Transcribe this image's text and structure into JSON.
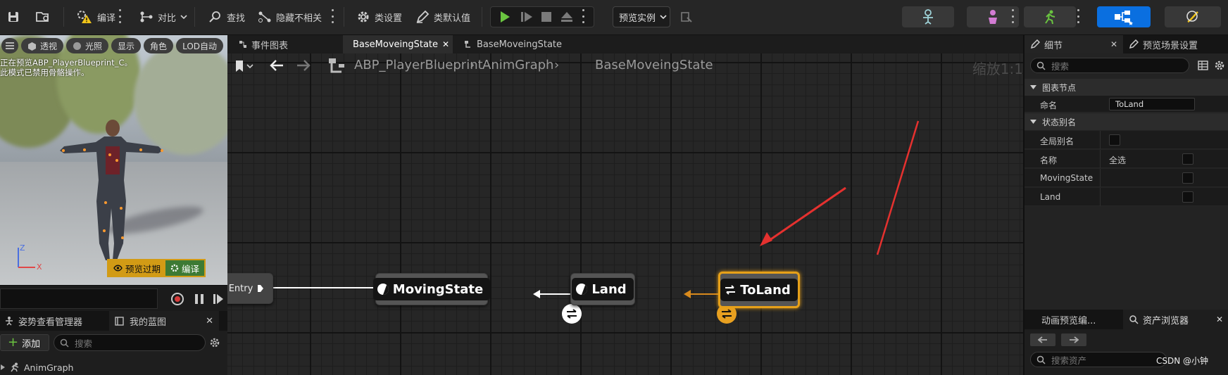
{
  "toolbar": {
    "compile_label": "编译",
    "diff_label": "对比",
    "find_label": "查找",
    "hide_unrelated_label": "隐藏不相关",
    "class_settings_label": "类设置",
    "class_defaults_label": "类默认值",
    "preview_instance_label": "预览实例"
  },
  "viewport": {
    "perspective_label": "透视",
    "lighting_label": "光照",
    "show_label": "显示",
    "character_label": "角色",
    "lod_label": "LOD自动",
    "info_line1": "正在预览ABP_PlayerBlueprint_C。",
    "info_line2": "此模式已禁用骨骼操作。",
    "axis_z": "Z",
    "axis_x": "X",
    "preview_outdated_label": "预览过期",
    "compile_badge_label": "编译"
  },
  "left_panel": {
    "tab_pose_watch": "姿势查看管理器",
    "tab_my_blueprint": "我的蓝图",
    "add_label": "添加",
    "search_placeholder": "搜索",
    "tree_item_animgraph": "AnimGraph"
  },
  "graph": {
    "tabs": [
      {
        "label": "事件图表"
      },
      {
        "label": "BaseMoveingState"
      },
      {
        "label": "BaseMoveingState"
      }
    ],
    "breadcrumb": [
      "ABP_PlayerBlueprint",
      "AnimGraph",
      "BaseMoveingState"
    ],
    "zoom_label": "缩放1:1",
    "nodes": {
      "entry": "Entry",
      "moving_state": "MovingState",
      "land": "Land",
      "to_land": "ToLand"
    }
  },
  "details": {
    "tab_details": "细节",
    "tab_preview_scene": "预览场景设置",
    "search_placeholder": "搜索",
    "category_graph_node": "图表节点",
    "name_label": "命名",
    "name_value": "ToLand",
    "category_state_alias": "状态别名",
    "global_alias_label": "全局别名",
    "name_row_label": "名称",
    "select_all_label": "全选",
    "alias_moving_state": "MovingState",
    "alias_land": "Land"
  },
  "assets": {
    "tab_anim_preview": "动画预览编...",
    "tab_asset_browser": "资产浏览器",
    "search_placeholder": "搜索资产",
    "watermark": "CSDN @小钟"
  },
  "colors": {
    "selected_node": "#e6a019",
    "annotation_arrow": "#e5312f",
    "play_green": "#6ac440",
    "blue_button": "#0a6fe0"
  }
}
